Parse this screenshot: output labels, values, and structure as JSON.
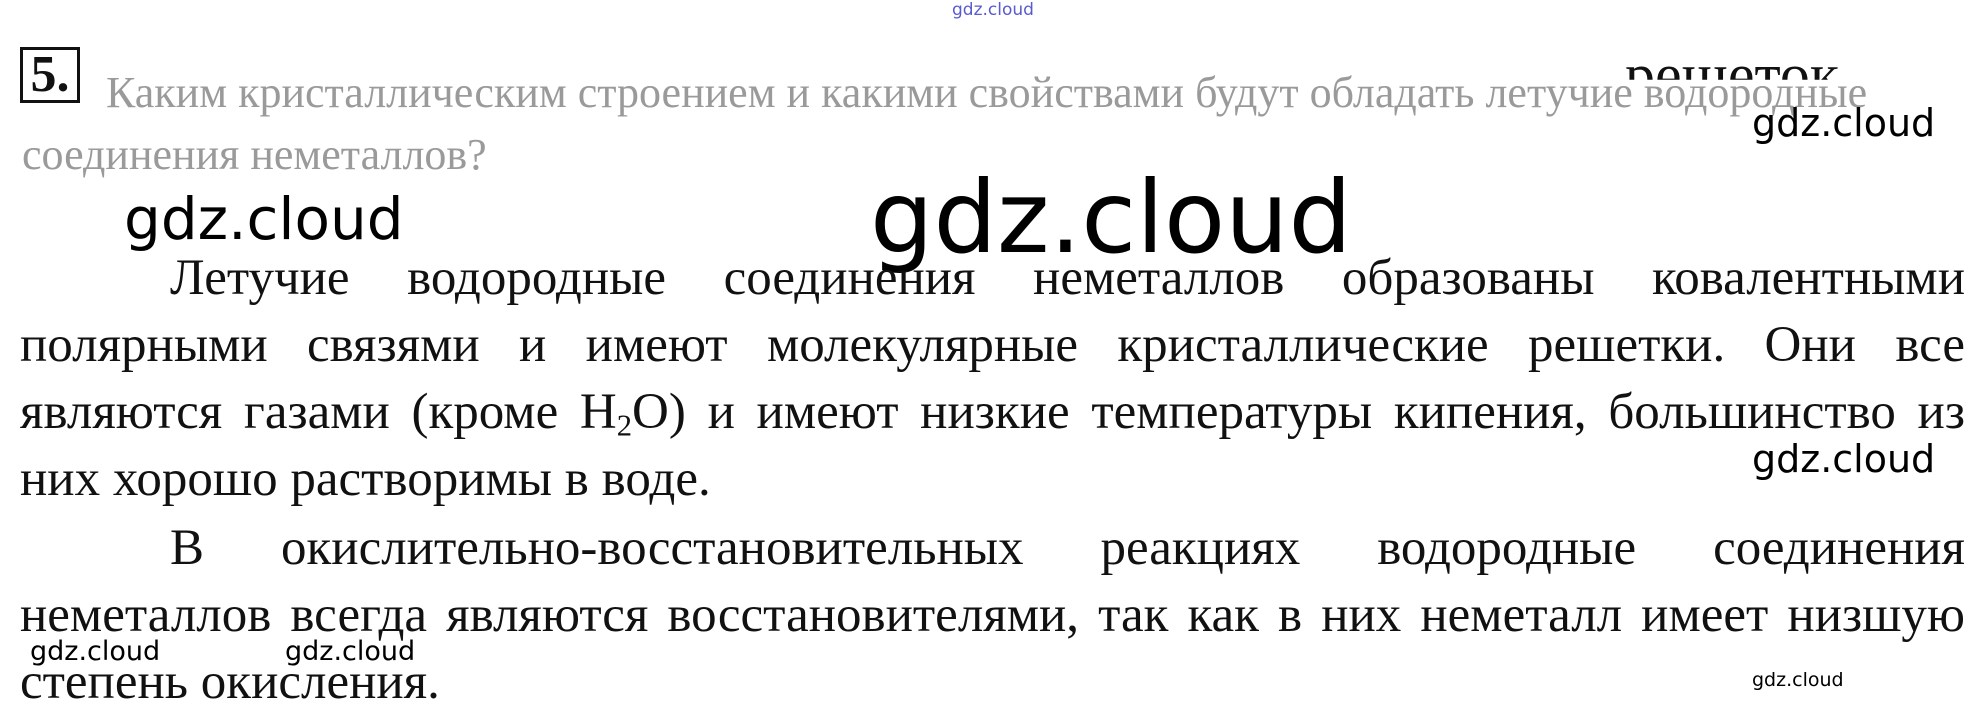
{
  "watermark": "gdz.cloud",
  "task_number": "5.",
  "question": "Каким кристаллическим строением и какими свойствами будут обладать летучие водородные соединения неметаллов?",
  "overlap_fragment": "решеток",
  "answer": {
    "p1_before": "Летучие водородные соединения неметаллов образованы ковалентными полярными связями и имеют молекулярные кристаллические решетки. Они все являются газами (кроме H",
    "p1_sub": "2",
    "p1_after": "O) и имеют низкие температуры кипения, большинство из них хорошо растворимы в воде.",
    "p2": "В окислительно-восстановительных реакциях водородные соединения неметаллов всегда являются восстановителями, так как в них неметалл имеет низшую степень окисления."
  }
}
